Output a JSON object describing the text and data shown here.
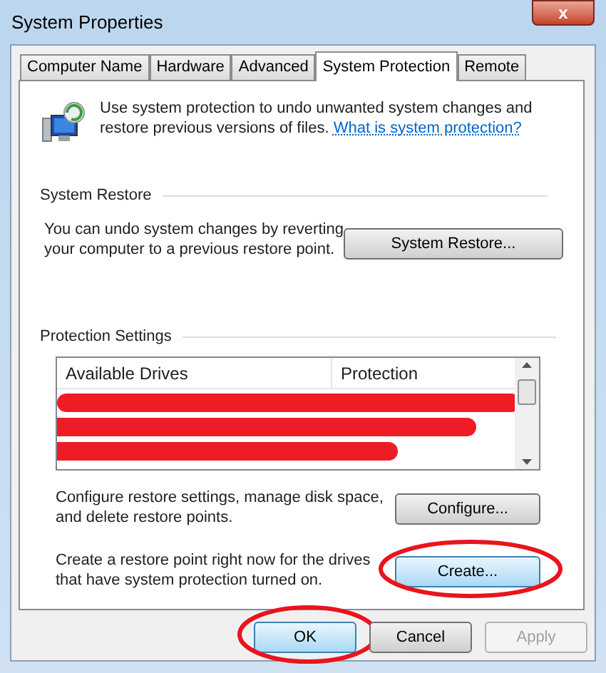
{
  "window": {
    "title": "System Properties",
    "close": "x"
  },
  "tabs": [
    {
      "label": "Computer Name",
      "selected": false
    },
    {
      "label": "Hardware",
      "selected": false
    },
    {
      "label": "Advanced",
      "selected": false
    },
    {
      "label": "System Protection",
      "selected": true
    },
    {
      "label": "Remote",
      "selected": false
    }
  ],
  "intro": {
    "text": "Use system protection to undo unwanted system changes and restore previous versions of files.",
    "link": "What is system protection?"
  },
  "system_restore": {
    "heading": "System Restore",
    "text": "You can undo system changes by reverting your computer to a previous restore point.",
    "button": {
      "label": "System Restore...",
      "highlighted": false,
      "circled": false
    }
  },
  "protection_settings": {
    "heading": "Protection Settings",
    "columns": [
      "Available Drives",
      "Protection"
    ],
    "rows": [
      {
        "kind": "redacted"
      },
      {
        "kind": "redacted"
      },
      {
        "kind": "redacted"
      }
    ],
    "actions": [
      {
        "text": "Configure restore settings, manage disk space, and delete restore points.",
        "button": {
          "label": "Configure...",
          "highlighted": false,
          "circled": false
        }
      },
      {
        "text": "Create a restore point right now for the drives that have system protection turned on.",
        "button": {
          "label": "Create...",
          "highlighted": true,
          "circled": true
        }
      }
    ]
  },
  "buttons": [
    {
      "label": "OK",
      "highlighted": true,
      "circled": true,
      "disabled": false
    },
    {
      "label": "Cancel",
      "highlighted": false,
      "circled": false,
      "disabled": false
    },
    {
      "label": "Apply",
      "highlighted": false,
      "circled": false,
      "disabled": true
    }
  ]
}
